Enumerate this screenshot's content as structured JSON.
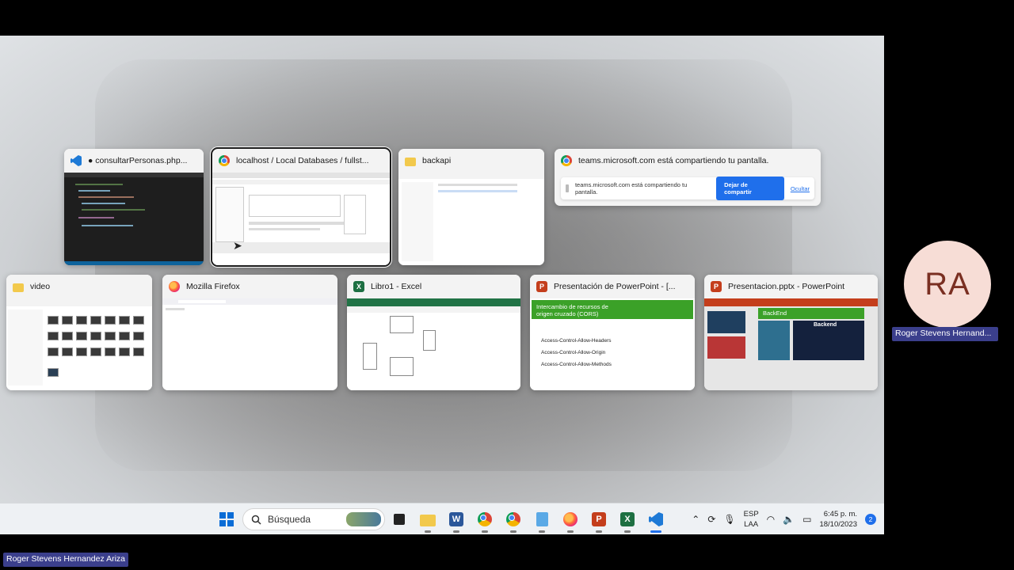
{
  "task_view": {
    "windows": [
      {
        "id": "vscode",
        "title": "● consultarPersonas.php...",
        "icon": "vscode-icon"
      },
      {
        "id": "chrome-localhost",
        "title": "localhost / Local Databases / fullst...",
        "icon": "chrome-icon"
      },
      {
        "id": "folder-backapi",
        "title": "backapi",
        "icon": "folder-icon"
      },
      {
        "id": "chrome-teams",
        "title": "teams.microsoft.com está compartiendo tu pantalla.",
        "icon": "chrome-icon",
        "share_bar": {
          "message": "teams.microsoft.com está compartiendo tu pantalla.",
          "stop_label": "Dejar de compartir",
          "hide_label": "Ocultar"
        }
      },
      {
        "id": "folder-video",
        "title": "video",
        "icon": "folder-icon"
      },
      {
        "id": "firefox",
        "title": "Mozilla Firefox",
        "icon": "firefox-icon"
      },
      {
        "id": "excel",
        "title": "Libro1 - Excel",
        "icon": "excel-icon"
      },
      {
        "id": "ppt1",
        "title": "Presentación de PowerPoint - [...",
        "icon": "powerpoint-icon",
        "slide": {
          "heading": "Intercambio de recursos de origen cruzado (CORS)",
          "bullets": [
            "Access-Control-Allow-Headers",
            "Access-Control-Allow-Origin",
            "Access-Control-Allow-Methods"
          ]
        }
      },
      {
        "id": "ppt2",
        "title": "Presentacion.pptx - PowerPoint",
        "icon": "powerpoint-icon",
        "slide": {
          "banner": "BackEnd",
          "panel": "Backend"
        }
      }
    ]
  },
  "taskbar": {
    "search_placeholder": "Búsqueda",
    "lang_line1": "ESP",
    "lang_line2": "LAA",
    "time": "6:45 p. m.",
    "date": "18/10/2023",
    "notifications": "2"
  },
  "meeting": {
    "avatar_initials": "RA",
    "participant_name": "Roger Stevens Hernand...",
    "presenter_name": "Roger Stevens Hernandez Ariza"
  },
  "colors": {
    "accent": "#1f6feb",
    "name_tag": "#3b3f8c",
    "avatar_bg": "#f7ddd6"
  }
}
